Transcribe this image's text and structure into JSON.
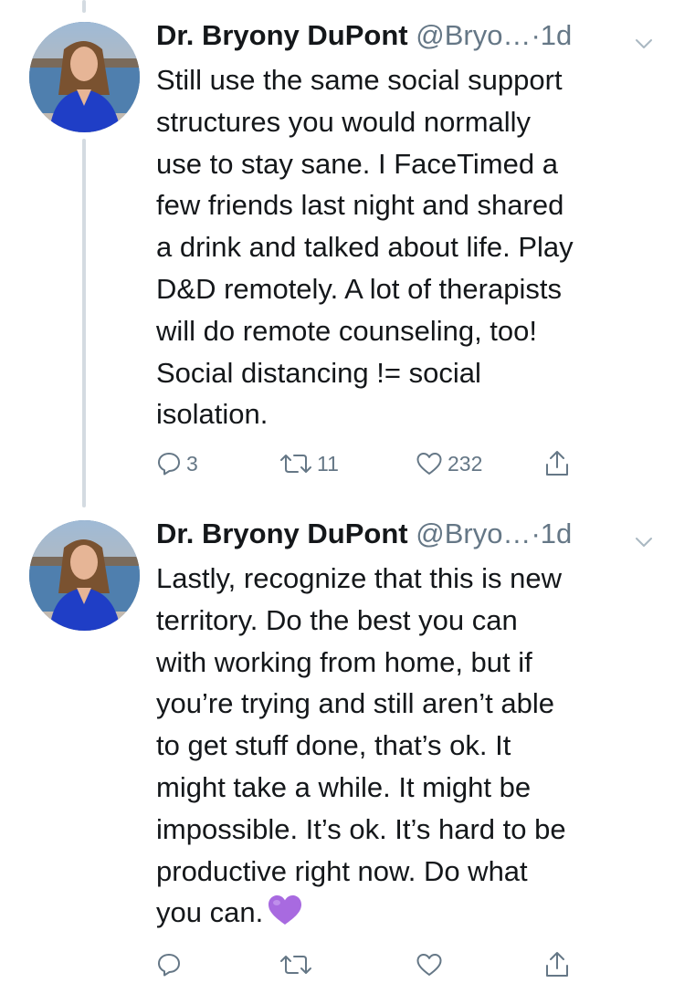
{
  "thread": {
    "tweets": [
      {
        "author": {
          "name": "Dr. Bryony DuPont",
          "handle": "@Bryo…",
          "avatar_icon": "profile-photo"
        },
        "separator": "·",
        "time": "1d",
        "lines": [
          "Still use the same social support",
          "structures you would normally",
          "use to stay sane. I FaceTimed a",
          "few friends last night and shared",
          "a drink and talked about life. Play",
          "D&D remotely. A lot of therapists",
          "will do remote counseling, too!",
          "Social distancing != social",
          "isolation."
        ],
        "stats": {
          "replies": "3",
          "retweets": "11",
          "likes": "232"
        }
      },
      {
        "author": {
          "name": "Dr. Bryony DuPont",
          "handle": "@Bryo…",
          "avatar_icon": "profile-photo"
        },
        "separator": "·",
        "time": "1d",
        "lines": [
          "Lastly, recognize that this is new",
          "territory. Do the best you can",
          "with working from home, but if",
          "you’re trying and still aren’t able",
          "to get stuff done, that’s ok. It",
          "might take a while. It might be",
          "impossible. It’s ok. It’s hard to be",
          "productive right now. Do what",
          "you can."
        ],
        "emoji": "purple-heart",
        "stats": {
          "replies": "",
          "retweets": "",
          "likes": ""
        }
      }
    ]
  },
  "colors": {
    "text": "#14171a",
    "secondary": "#657786",
    "thread_line": "#d4dbe1",
    "purple_heart": "#a86ae0"
  },
  "icons": {
    "reply": "reply-icon",
    "retweet": "retweet-icon",
    "like": "heart-icon",
    "share": "share-icon",
    "menu": "chevron-down-icon"
  }
}
